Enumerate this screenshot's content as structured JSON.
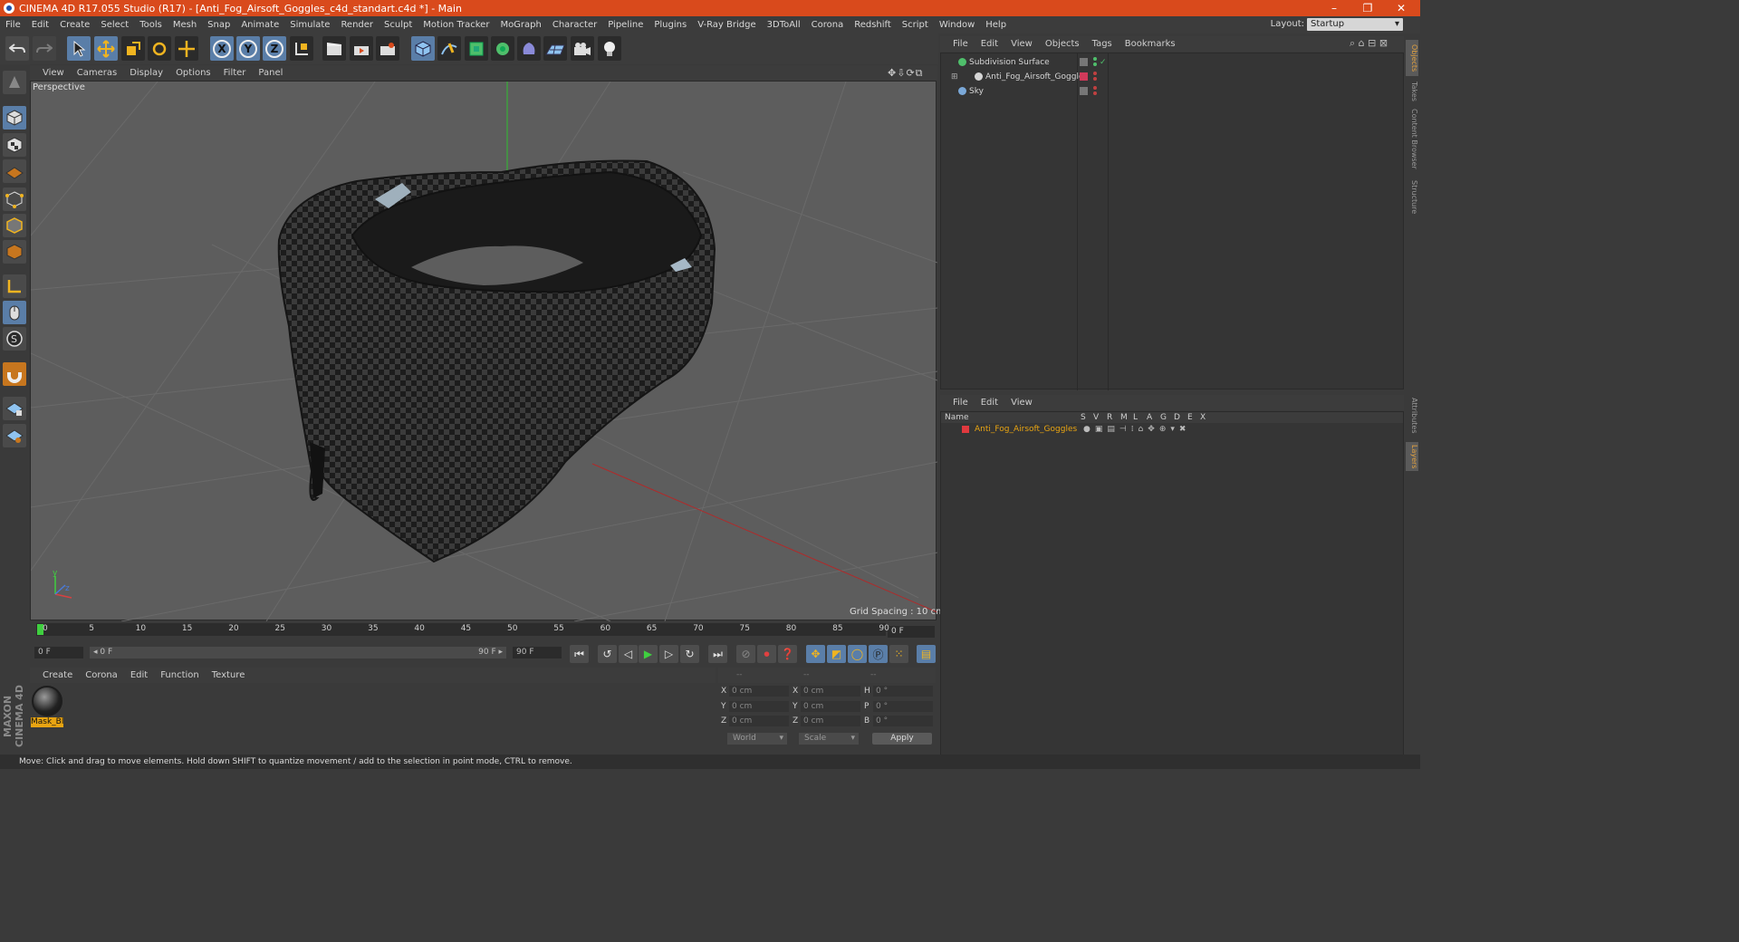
{
  "window": {
    "title": "CINEMA 4D R17.055 Studio (R17) - [Anti_Fog_Airsoft_Goggles_c4d_standart.c4d *] - Main",
    "minimize": "–",
    "maximize": "❐",
    "close": "✕"
  },
  "menubar": [
    "File",
    "Edit",
    "Create",
    "Select",
    "Tools",
    "Mesh",
    "Snap",
    "Animate",
    "Simulate",
    "Render",
    "Sculpt",
    "Motion Tracker",
    "MoGraph",
    "Character",
    "Pipeline",
    "Plugins",
    "V-Ray Bridge",
    "3DToAll",
    "Corona",
    "Redshift",
    "Script",
    "Window",
    "Help"
  ],
  "layout": {
    "label": "Layout:",
    "value": "Startup"
  },
  "toolbar": {
    "axis_x": "X",
    "axis_y": "Y",
    "axis_z": "Z"
  },
  "viewport": {
    "menu": [
      "View",
      "Cameras",
      "Display",
      "Options",
      "Filter",
      "Panel"
    ],
    "title": "Perspective",
    "grid_spacing": "Grid Spacing : 10 cm",
    "axis_y": "y",
    "axis_z": "z"
  },
  "timeline": {
    "ticks": [
      "0",
      "5",
      "10",
      "15",
      "20",
      "25",
      "30",
      "35",
      "40",
      "45",
      "50",
      "55",
      "60",
      "65",
      "70",
      "75",
      "80",
      "85",
      "90"
    ],
    "current_frame": "0 F",
    "start_field": "0 F",
    "range_start": "◂ 0 F",
    "range_end": "90 F ▸",
    "end_field": "90 F"
  },
  "material_manager": {
    "menu": [
      "Create",
      "Corona",
      "Edit",
      "Function",
      "Texture"
    ],
    "material_name": "Mask_Bl"
  },
  "coordinates": {
    "headers": [
      "--",
      "--",
      "--"
    ],
    "rows": [
      {
        "a": "X",
        "av": "0 cm",
        "b": "X",
        "bv": "0 cm",
        "c": "H",
        "cv": "0 °"
      },
      {
        "a": "Y",
        "av": "0 cm",
        "b": "Y",
        "bv": "0 cm",
        "c": "P",
        "cv": "0 °"
      },
      {
        "a": "Z",
        "av": "0 cm",
        "b": "Z",
        "bv": "0 cm",
        "c": "B",
        "cv": "0 °"
      }
    ],
    "world": "World",
    "scale": "Scale",
    "apply": "Apply"
  },
  "object_manager": {
    "menu": [
      "File",
      "Edit",
      "View",
      "Objects",
      "Tags",
      "Bookmarks"
    ],
    "objects": [
      {
        "name": "Subdivision Surface",
        "color": "#4fbf6b"
      },
      {
        "name": "Anti_Fog_Airsoft_Goggles",
        "color": "#d6d6d6"
      },
      {
        "name": "Sky",
        "color": "#7aa8d8"
      }
    ]
  },
  "layer_manager": {
    "menu": [
      "File",
      "Edit",
      "View"
    ],
    "columns": [
      "Name",
      "S",
      "V",
      "R",
      "M",
      "L",
      "A",
      "G",
      "D",
      "E",
      "X"
    ],
    "layers": [
      {
        "name": "Anti_Fog_Airsoft_Goggles",
        "color": "#e0393e"
      }
    ]
  },
  "right_tabs": [
    "Objects",
    "Takes",
    "Content Browser",
    "Structure",
    "Attributes",
    "Layers"
  ],
  "statusbar": "Move: Click and drag to move elements. Hold down SHIFT to quantize movement / add to the selection in point mode, CTRL to remove.",
  "brand": "MAXON CINEMA 4D",
  "colors": {
    "titlebar": "#d94a1c",
    "accent": "#5a7ea8",
    "selected_layer": "#e8a412"
  }
}
